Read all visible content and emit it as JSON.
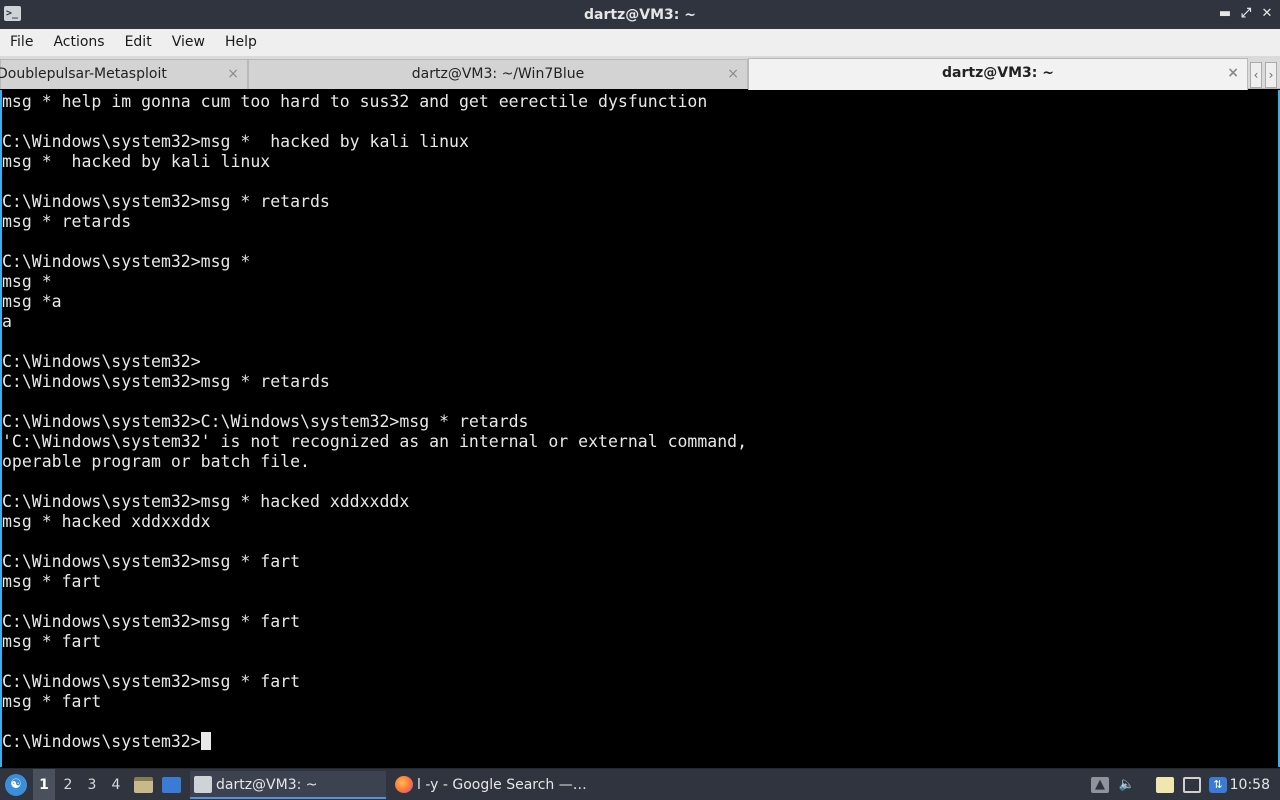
{
  "window": {
    "title": "dartz@VM3: ~",
    "app_icon": "terminal-icon",
    "controls": [
      "minimize-icon",
      "maximize-icon",
      "close-icon"
    ]
  },
  "menu": [
    "File",
    "Actions",
    "Edit",
    "View",
    "Help"
  ],
  "tabs": [
    {
      "label": "Doublepulsar-Metasploit",
      "active": false
    },
    {
      "label": "dartz@VM3: ~/Win7Blue",
      "active": false
    },
    {
      "label": "dartz@VM3: ~",
      "active": true
    }
  ],
  "tab_close_glyph": "×",
  "terminal": {
    "lines": [
      "msg * help im gonna cum too hard to sus32 and get eerectile dysfunction",
      "",
      "C:\\Windows\\system32>msg *  hacked by kali linux",
      "msg *  hacked by kali linux",
      "",
      "C:\\Windows\\system32>msg * retards",
      "msg * retards",
      "",
      "C:\\Windows\\system32>msg *",
      "msg *",
      "msg *a",
      "a",
      "",
      "C:\\Windows\\system32>",
      "C:\\Windows\\system32>msg * retards",
      "",
      "C:\\Windows\\system32>C:\\Windows\\system32>msg * retards",
      "'C:\\Windows\\system32' is not recognized as an internal or external command,",
      "operable program or batch file.",
      "",
      "C:\\Windows\\system32>msg * hacked xddxxddx",
      "msg * hacked xddxxddx",
      "",
      "C:\\Windows\\system32>msg * fart",
      "msg * fart",
      "",
      "C:\\Windows\\system32>msg * fart",
      "msg * fart",
      "",
      "C:\\Windows\\system32>msg * fart",
      "msg * fart",
      "",
      "C:\\Windows\\system32>"
    ]
  },
  "taskbar": {
    "workspaces": [
      "1",
      "2",
      "3",
      "4"
    ],
    "active_workspace": "1",
    "tasks": [
      {
        "label": "dartz@VM3: ~",
        "icon": "terminal-icon",
        "active": true
      },
      {
        "label": "l -y - Google Search —…",
        "icon": "firefox-icon",
        "active": false
      }
    ],
    "tray_icons": [
      "upload-icon",
      "volume-icon",
      "clipboard-icon",
      "display-icon",
      "network-icon"
    ],
    "clock": "10:58"
  },
  "colors": {
    "titlebar_bg": "#2f343f",
    "terminal_bg": "#000000",
    "terminal_fg": "#e8e8e8",
    "accent": "#3daee9"
  }
}
